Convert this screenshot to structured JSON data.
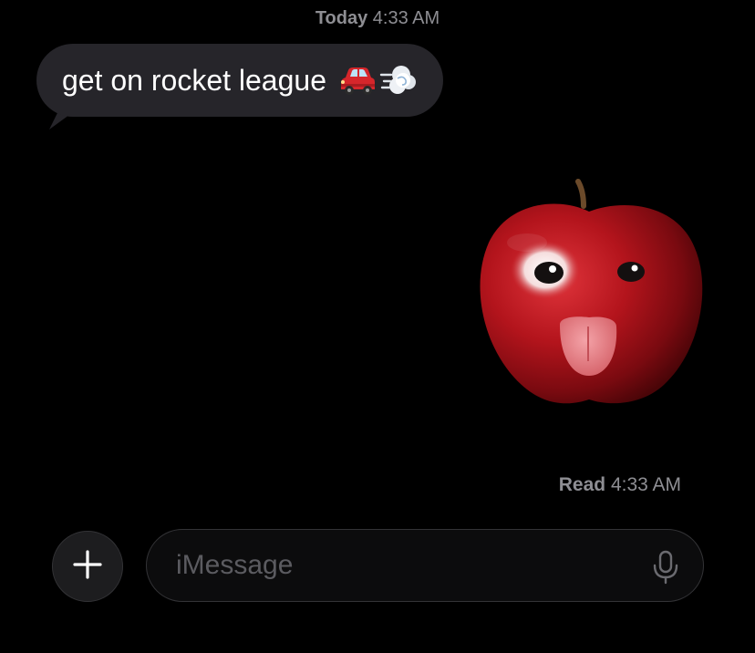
{
  "header": {
    "day_label": "Today",
    "time_label": "4:33 AM"
  },
  "messages": [
    {
      "direction": "incoming",
      "text": "get on rocket league",
      "emojis": [
        "red-car-icon",
        "dash-cloud-icon"
      ]
    },
    {
      "direction": "outgoing",
      "type": "sticker",
      "sticker": "apple-face-tongue-sticker"
    }
  ],
  "read_receipt": {
    "status_label": "Read",
    "time_label": "4:33 AM"
  },
  "composer": {
    "placeholder": "iMessage",
    "plus_icon": "plus-icon",
    "mic_icon": "microphone-icon"
  },
  "colors": {
    "background": "#000000",
    "incoming_bubble": "#26252a",
    "secondary_text": "#8e8e93",
    "input_border": "#333336"
  }
}
